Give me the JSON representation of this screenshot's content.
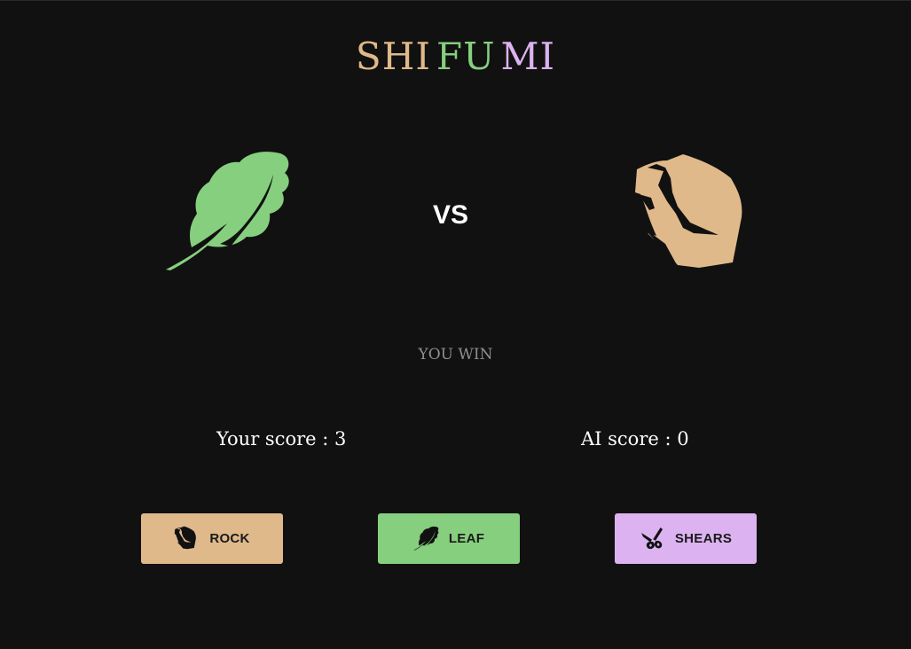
{
  "title": {
    "part1": "SHI",
    "part2": "FU",
    "part3": "MI",
    "colors": {
      "part1": "#e0b98a",
      "part2": "#86cf7e",
      "part3": "#dcb2f0"
    }
  },
  "arena": {
    "player_choice_icon": "leaf-icon",
    "ai_choice_icon": "rock-icon",
    "vs_label": "VS",
    "result": "YOU WIN"
  },
  "scores": {
    "player": "Your score : 3",
    "ai": "AI score : 0"
  },
  "choices": [
    {
      "label": "ROCK",
      "icon": "rock-icon",
      "color": "#e0b98a"
    },
    {
      "label": "LEAF",
      "icon": "leaf-icon",
      "color": "#86cf7e"
    },
    {
      "label": "SHEARS",
      "icon": "shears-icon",
      "color": "#dcb2f0"
    }
  ],
  "colors": {
    "background": "#111111",
    "text": "#ffffff",
    "muted": "#8f8f8f"
  }
}
